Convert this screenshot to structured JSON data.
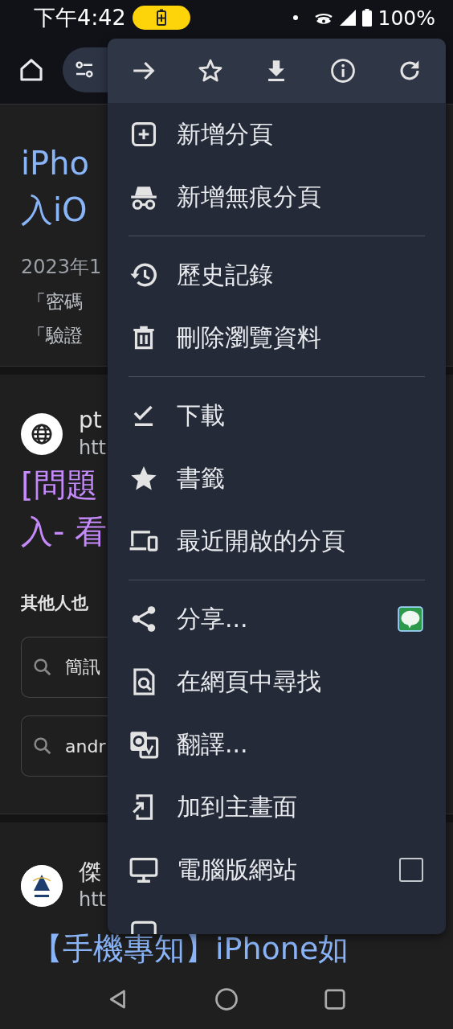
{
  "status_bar": {
    "time": "下午4:42",
    "battery": "100%"
  },
  "page": {
    "result1": {
      "title": [
        "iPho",
        "入iO"
      ],
      "date": "2023年1",
      "snippets": [
        "「密碼",
        "「驗證"
      ]
    },
    "result2": {
      "site": "pt",
      "url": "htt",
      "title": [
        "[問題",
        "入- 看"
      ]
    },
    "related": {
      "heading": "其他人也",
      "searches": [
        "簡訊",
        "andr"
      ]
    },
    "result3": {
      "site": "傑",
      "url": "htt"
    },
    "bottom_title": "【手機專知】iPhone如"
  },
  "menu": {
    "groups": [
      [
        {
          "label": "新增分頁",
          "kind": "plain"
        },
        {
          "label": "新增無痕分頁",
          "kind": "plain"
        }
      ],
      [
        {
          "label": "歷史記錄",
          "kind": "plain"
        },
        {
          "label": "刪除瀏覽資料",
          "kind": "plain"
        }
      ],
      [
        {
          "label": "下載",
          "kind": "plain"
        },
        {
          "label": "書籤",
          "kind": "plain"
        },
        {
          "label": "最近開啟的分頁",
          "kind": "plain"
        }
      ],
      [
        {
          "label": "分享...",
          "kind": "share"
        },
        {
          "label": "在網頁中尋找",
          "kind": "plain"
        },
        {
          "label": "翻譯...",
          "kind": "plain"
        },
        {
          "label": "加到主畫面",
          "kind": "plain"
        },
        {
          "label": "電腦版網站",
          "kind": "checkbox",
          "checked": false
        },
        {
          "kind": "cutoff"
        }
      ]
    ]
  }
}
